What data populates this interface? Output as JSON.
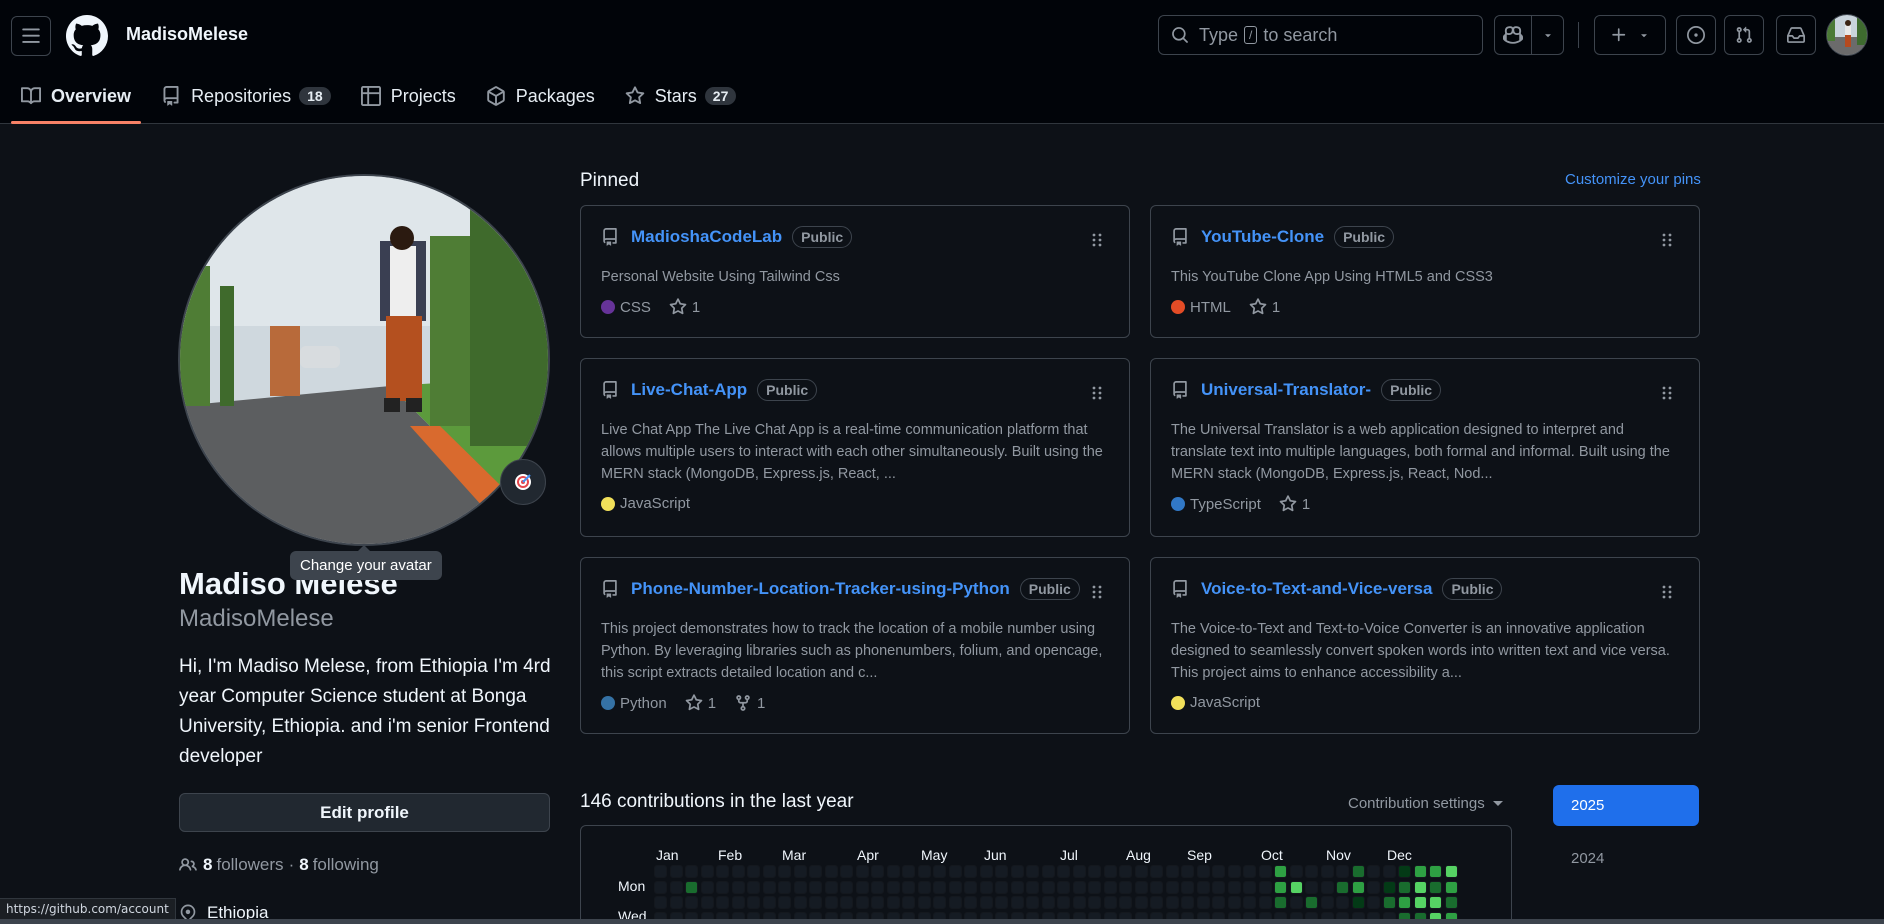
{
  "header": {
    "username": "MadisoMelese",
    "search_prefix": "Type",
    "search_key": "/",
    "search_suffix": "to search"
  },
  "tabs": [
    {
      "label": "Overview",
      "count": null
    },
    {
      "label": "Repositories",
      "count": "18"
    },
    {
      "label": "Projects",
      "count": null
    },
    {
      "label": "Packages",
      "count": null
    },
    {
      "label": "Stars",
      "count": "27"
    }
  ],
  "profile": {
    "tooltip": "Change your avatar",
    "full_name": "Madiso Melese",
    "login": "MadisoMelese",
    "bio": "Hi, I'm Madiso Melese, from Ethiopia I'm 4rd year Computer Science student at Bonga University, Ethiopia. and i'm senior Frontend developer",
    "edit_label": "Edit profile",
    "followers_count": "8",
    "followers_label": "followers",
    "dot": "·",
    "following_count": "8",
    "following_label": "following",
    "location": "Ethiopia"
  },
  "pinned": {
    "title": "Pinned",
    "customize": "Customize your pins",
    "cards": [
      {
        "name": "MadioshaCodeLab",
        "visibility": "Public",
        "description": "Personal Website Using Tailwind Css",
        "language": "CSS",
        "lang_color": "#663399",
        "stars": "1",
        "forks": null
      },
      {
        "name": "YouTube-Clone",
        "visibility": "Public",
        "description": "This YouTube Clone App Using HTML5 and CSS3",
        "language": "HTML",
        "lang_color": "#e34c26",
        "stars": "1",
        "forks": null
      },
      {
        "name": "Live-Chat-App",
        "visibility": "Public",
        "description": "Live Chat App The Live Chat App is a real-time communication platform that allows multiple users to interact with each other simultaneously. Built using the MERN stack (MongoDB, Express.js, React, ...",
        "language": "JavaScript",
        "lang_color": "#f1e05a",
        "stars": null,
        "forks": null
      },
      {
        "name": "Universal-Translator-",
        "visibility": "Public",
        "description": "The Universal Translator is a web application designed to interpret and translate text into multiple languages, both formal and informal. Built using the MERN stack (MongoDB, Express.js, React, Nod...",
        "language": "TypeScript",
        "lang_color": "#3178c6",
        "stars": "1",
        "forks": null
      },
      {
        "name": "Phone-Number-Location-Tracker-using-Python",
        "visibility": "Public",
        "description": "This project demonstrates how to track the location of a mobile number using Python. By leveraging libraries such as phonenumbers, folium, and opencage, this script extracts detailed location and c...",
        "language": "Python",
        "lang_color": "#3572a5",
        "stars": "1",
        "forks": "1"
      },
      {
        "name": "Voice-to-Text-and-Vice-versa",
        "visibility": "Public",
        "description": "The Voice-to-Text and Text-to-Voice Converter is an innovative application designed to seamlessly convert spoken words into written text and vice versa. This project aims to enhance accessibility a...",
        "language": "JavaScript",
        "lang_color": "#f1e05a",
        "stars": null,
        "forks": null
      }
    ]
  },
  "contributions": {
    "title": "146 contributions in the last year",
    "settings": "Contribution settings",
    "months": [
      "Jan",
      "Feb",
      "Mar",
      "Apr",
      "May",
      "Jun",
      "Jul",
      "Aug",
      "Sep",
      "Oct",
      "Nov",
      "Dec"
    ],
    "days": [
      "Mon",
      "Wed"
    ],
    "years": [
      "2025",
      "2024"
    ],
    "level_colors": [
      "#151b23",
      "#033a16",
      "#196c2e",
      "#2ea043",
      "#56d364"
    ]
  },
  "statusbar": "https://github.com/account"
}
